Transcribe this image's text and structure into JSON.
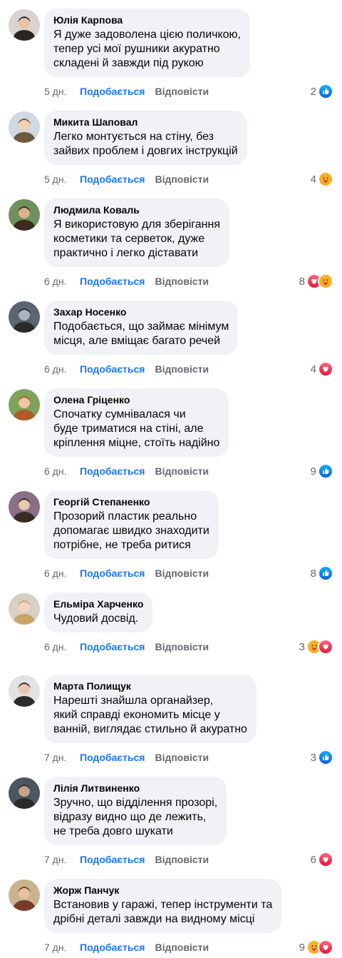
{
  "actions": {
    "like_label": "Подобається",
    "reply_label": "Відповісти"
  },
  "colors": {
    "like": "#1877f2",
    "heart": "#f33e58",
    "care": "#f7b125",
    "bubble": "#f0f2f5"
  },
  "comments": [
    {
      "author": "Юлія Карпова",
      "text": "Я дуже задоволена цією поличкою,\nтепер усі мої рушники акуратно\nскладені й завжди під рукою",
      "time": "5 дн.",
      "reaction_count": "2",
      "reactions": [
        "like-icon"
      ]
    },
    {
      "author": "Микита Шаповал",
      "text": "Легко монтується на стіну, без\nзайвих проблем і довгих інструкцій",
      "time": "5 дн.",
      "reaction_count": "4",
      "reactions": [
        "care-icon"
      ]
    },
    {
      "author": "Людмила Коваль",
      "text": "Я використовую для зберігання\nкосметики та серветок, дуже\nпрактично і легко діставати",
      "time": "6 дн.",
      "reaction_count": "8",
      "reactions": [
        "heart-icon",
        "care-icon"
      ]
    },
    {
      "author": "Захар Носенко",
      "text": "Подобається, що займає мінімум\nмісця, але вміщає багато речей",
      "time": "6 дн.",
      "reaction_count": "4",
      "reactions": [
        "heart-icon"
      ]
    },
    {
      "author": "Олена Гріценко",
      "text": "Спочатку сумнівалася чи\nбуде триматися на стіні, але\nкріплення міцне, стоїть надійно",
      "time": "6 дн.",
      "reaction_count": "9",
      "reactions": [
        "like-icon"
      ]
    },
    {
      "author": "Георгій Степаненко",
      "text": "Прозорий пластик реально\nдопомагає швидко знаходити\nпотрібне, не треба ритися",
      "time": "6 дн.",
      "reaction_count": "8",
      "reactions": [
        "like-icon"
      ]
    },
    {
      "author": "Ельміра Харченко",
      "text": "Чудовий досвід.",
      "time": "6 дн.",
      "reaction_count": "3",
      "reactions": [
        "care-icon",
        "heart-icon"
      ]
    },
    {
      "author": "Марта Полищук",
      "text": "Нарешті знайшла органайзер,\nякий справді економить місце у\nванній, виглядає стильно й акуратно",
      "time": "7 дн.",
      "reaction_count": "3",
      "reactions": [
        "like-icon"
      ]
    },
    {
      "author": "Лілія Литвиненко",
      "text": "Зручно, що відділення прозорі,\nвідразу видно що де лежить,\nне треба довго шукати",
      "time": "7 дн.",
      "reaction_count": "6",
      "reactions": [
        "heart-icon"
      ]
    },
    {
      "author": "Жорж Панчук",
      "text": "Встановив у гаражі, тепер інструменти та\nдрібні деталі завжди на видному місці",
      "time": "7 дн.",
      "reaction_count": "9",
      "reactions": [
        "care-icon",
        "heart-icon"
      ]
    }
  ]
}
